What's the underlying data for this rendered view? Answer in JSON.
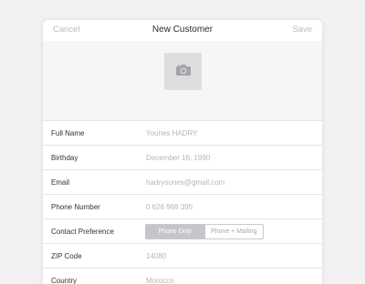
{
  "navbar": {
    "cancel_label": "Cancel",
    "title": "New Customer",
    "save_label": "Save"
  },
  "photo": {
    "icon": "camera-icon"
  },
  "fields": {
    "full_name": {
      "label": "Full Name",
      "value": "Younes HADRY"
    },
    "birthday": {
      "label": "Birthday",
      "value": "December 16, 1990"
    },
    "email": {
      "label": "Email",
      "value": "hadryounes@gmail.com"
    },
    "phone": {
      "label": "Phone Number",
      "value": "0 626 968 395"
    },
    "contact_pref": {
      "label": "Contact Preference",
      "options": [
        "Phone Only",
        "Phone + Mailing"
      ],
      "selected": "Phone Only"
    },
    "zip": {
      "label": "ZIP Code",
      "value": "14080"
    },
    "country": {
      "label": "Country",
      "value": "Morocco"
    }
  },
  "colors": {
    "background": "#f2f2f4",
    "card": "#ffffff",
    "segment_active": "#c6c6ca"
  }
}
